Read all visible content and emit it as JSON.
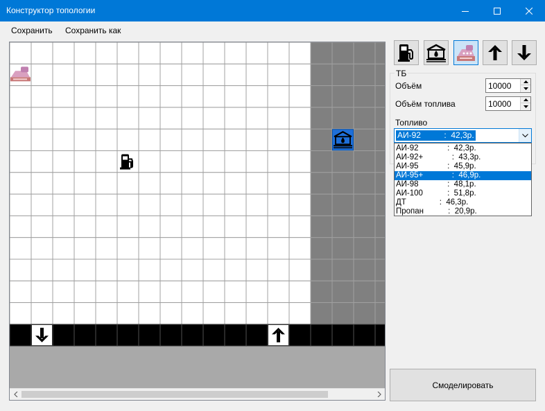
{
  "window": {
    "title": "Конструктор топологии"
  },
  "menu": {
    "save": "Сохранить",
    "save_as": "Сохранить как"
  },
  "toolbar": {
    "tools": [
      {
        "icon": "fuel-pump-icon"
      },
      {
        "icon": "fuel-tank-icon"
      },
      {
        "icon": "cash-register-icon",
        "active": true
      },
      {
        "icon": "entry-arrow-up-icon"
      },
      {
        "icon": "exit-arrow-down-icon"
      }
    ]
  },
  "properties": {
    "group_title": "ТБ",
    "volume_label": "Объём",
    "volume_value": "10000",
    "fuel_volume_label": "Объём топлива",
    "fuel_volume_value": "10000",
    "fuel_label": "Топливо",
    "fuel_selected": "АИ-92          :  42,3р.",
    "fuel_options": [
      "АИ-92             :  42,3р.",
      "АИ-92+             :  43,3р.",
      "АИ-95             :  45,9р.",
      "АИ-95+             :  46,9р.",
      "АИ-98             :  48,1р.",
      "АИ-100           :  51,8р.",
      "ДТ               :  46,3р.",
      "Пропан           :  20,9р."
    ],
    "fuel_highlighted_index": 3
  },
  "actions": {
    "simulate": "Смоделировать"
  },
  "grid": {
    "columns": 18,
    "rows": 13,
    "cell_color_light": "#ffffff",
    "cell_color_dark": "#808080",
    "road_color": "#000000",
    "dark_zone_from_column": 14,
    "road_row": 13,
    "objects": [
      {
        "type": "cash-register",
        "col": 0,
        "row": 1
      },
      {
        "type": "fuel-pump",
        "col": 5,
        "row": 5
      },
      {
        "type": "fuel-tank",
        "col": 15,
        "row": 4
      },
      {
        "type": "exit-down",
        "col": 1,
        "row": 13
      },
      {
        "type": "entry-up",
        "col": 12,
        "row": 13
      }
    ]
  }
}
